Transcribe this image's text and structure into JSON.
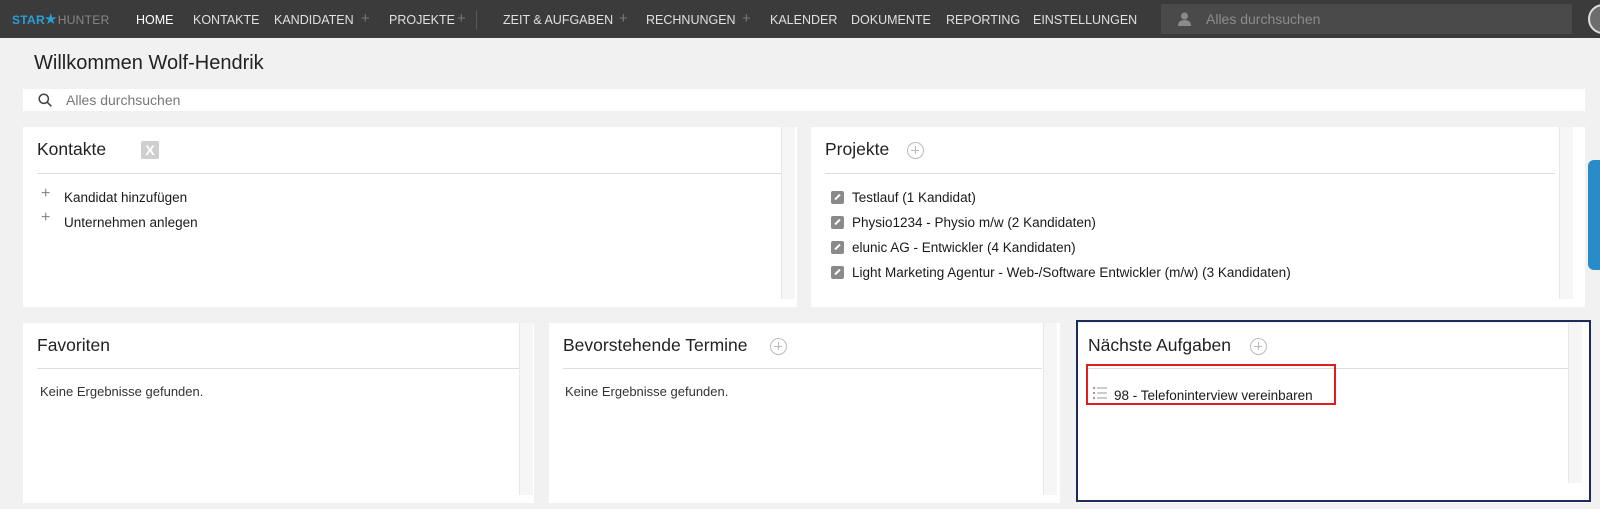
{
  "logo": {
    "part1": "STAR",
    "part2": "HUNTER"
  },
  "nav": {
    "home": "HOME",
    "kontakte": "KONTAKTE",
    "kandidaten": "KANDIDATEN",
    "projekte": "PROJEKTE",
    "zeit": "ZEIT & AUFGABEN",
    "rechnungen": "RECHNUNGEN",
    "kalender": "KALENDER",
    "dokumente": "DOKUMENTE",
    "reporting": "REPORTING",
    "einstellungen": "EINSTELLUNGEN",
    "plus": "+",
    "search_placeholder": "Alles durchsuchen"
  },
  "welcome": "Willkommen Wolf-Hendrik",
  "search": {
    "placeholder": "Alles durchsuchen"
  },
  "kontakte": {
    "title": "Kontakte",
    "xing": "X",
    "actions": [
      "Kandidat hinzufügen",
      "Unternehmen anlegen"
    ]
  },
  "projekte": {
    "title": "Projekte",
    "items": [
      "Testlauf (1 Kandidat)",
      "Physio1234 - Physio m/w (2 Kandidaten)",
      "elunic AG - Entwickler (4 Kandidaten)",
      "Light Marketing Agentur - Web-/Software Entwickler (m/w) (3 Kandidaten)"
    ]
  },
  "favoriten": {
    "title": "Favoriten",
    "empty": "Keine Ergebnisse gefunden."
  },
  "termine": {
    "title": "Bevorstehende Termine",
    "empty": "Keine Ergebnisse gefunden."
  },
  "aufgaben": {
    "title": "Nächste Aufgaben",
    "items": [
      "98 - Telefoninterview vereinbaren"
    ]
  },
  "colors": {
    "nav_bg": "#3b3b3b",
    "brand": "#2a9fd6",
    "highlight": "#1e2a5a",
    "alert": "#e01e1e"
  }
}
